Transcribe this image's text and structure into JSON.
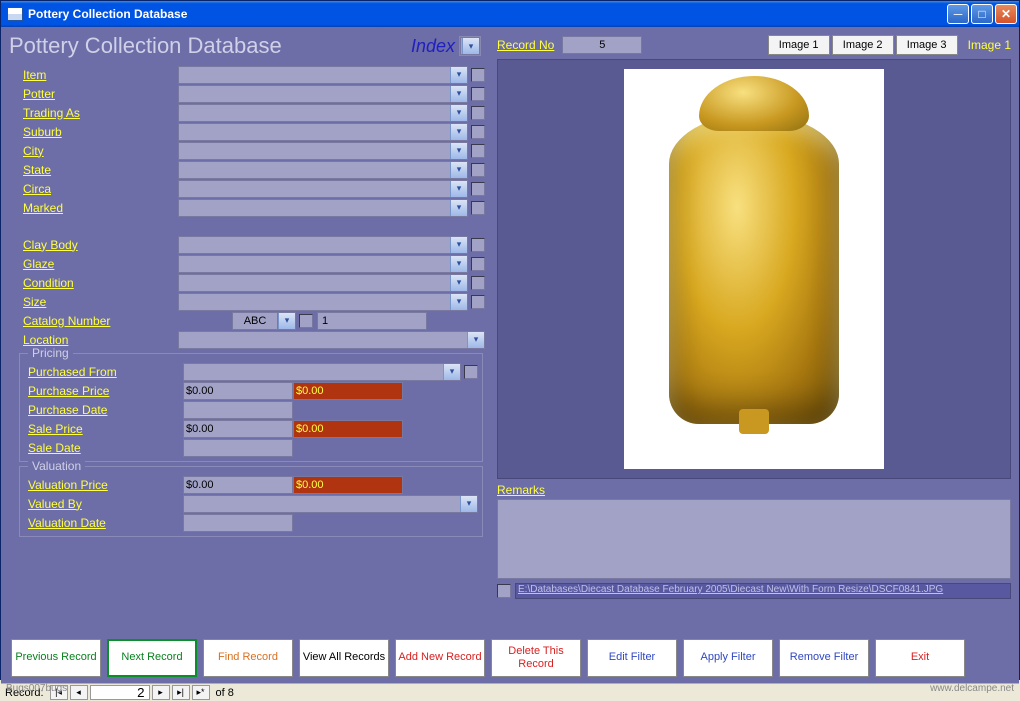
{
  "window": {
    "title": "Pottery Collection Database"
  },
  "heading": {
    "title": "Pottery Collection Database",
    "index": "Index"
  },
  "fields1": [
    {
      "label": "Item"
    },
    {
      "label": "Potter"
    },
    {
      "label": "Trading As"
    },
    {
      "label": "Suburb"
    },
    {
      "label": "City"
    },
    {
      "label": "State"
    },
    {
      "label": "Circa"
    },
    {
      "label": "Marked"
    }
  ],
  "fields2": [
    {
      "label": "Clay Body"
    },
    {
      "label": "Glaze"
    },
    {
      "label": "Condition"
    },
    {
      "label": "Size"
    }
  ],
  "catalog": {
    "label": "Catalog Number",
    "prefix": "ABC",
    "num": "1"
  },
  "location": {
    "label": "Location"
  },
  "pricing": {
    "title": "Pricing",
    "purchased_from": "Purchased From",
    "purchase_price": "Purchase Price",
    "purchase_price_v": "$0.00",
    "purchase_price_v2": "$0.00",
    "purchase_date": "Purchase Date",
    "sale_price": "Sale Price",
    "sale_price_v": "$0.00",
    "sale_price_v2": "$0.00",
    "sale_date": "Sale Date"
  },
  "valuation": {
    "title": "Valuation",
    "valuation_price": "Valuation Price",
    "valuation_price_v": "$0.00",
    "valuation_price_v2": "$0.00",
    "valued_by": "Valued By",
    "valuation_date": "Valuation Date"
  },
  "right": {
    "record_no": "Record No",
    "record_val": "5",
    "image_buttons": [
      "Image 1",
      "Image 2",
      "Image 3"
    ],
    "current_image": "Image 1",
    "remarks": "Remarks",
    "path": "E:\\Databases\\Diecast Database February 2005\\Diecast New\\With Form Resize\\DSCF0841.JPG"
  },
  "buttons": {
    "prev": "Previous Record",
    "next": "Next Record",
    "find": "Find Record",
    "viewall": "View All Records",
    "addnew": "Add New Record",
    "delete": "Delete This Record",
    "editfilter": "Edit Filter",
    "applyfilter": "Apply Filter",
    "removefilter": "Remove Filter",
    "exit": "Exit"
  },
  "recnav": {
    "label": "Record:",
    "current": "2",
    "total": "of  8"
  },
  "footer": {
    "left": "Bugs007bugs",
    "right": "www.delcampe.net"
  }
}
